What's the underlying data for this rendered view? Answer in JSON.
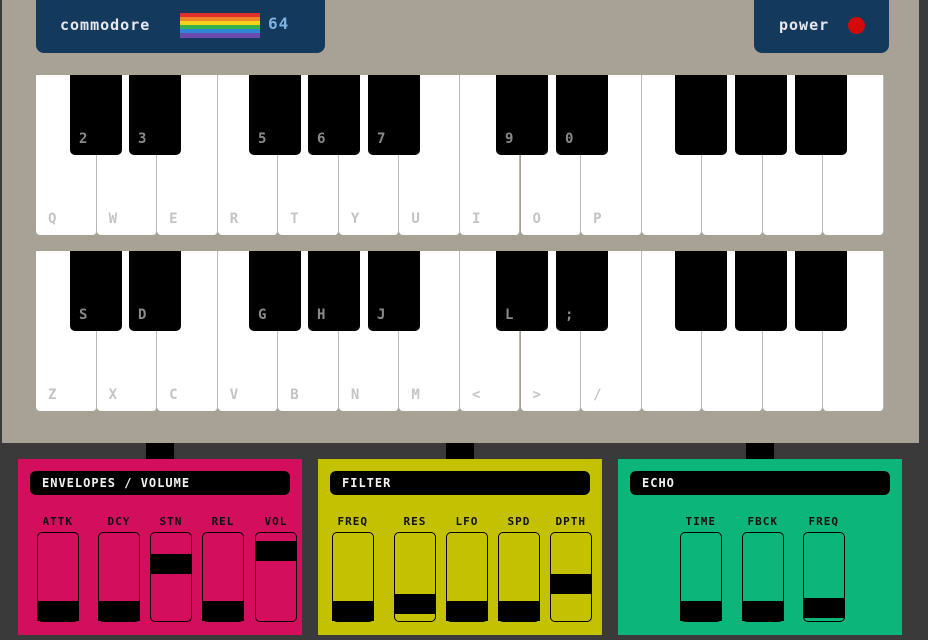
{
  "brand": {
    "name": "commodore",
    "model": "64"
  },
  "power": {
    "label": "power",
    "led_color": "#d40a0a"
  },
  "keyboard_top": {
    "white_labels": [
      "Q",
      "W",
      "E",
      "R",
      "T",
      "Y",
      "U",
      "I",
      "O",
      "P",
      "",
      "",
      "",
      ""
    ],
    "black_labels": [
      "2",
      "3",
      "5",
      "6",
      "7",
      "9",
      "0",
      "",
      "",
      ""
    ]
  },
  "keyboard_bottom": {
    "white_labels": [
      "Z",
      "X",
      "C",
      "V",
      "B",
      "N",
      "M",
      "<",
      ">",
      "/",
      "",
      "",
      "",
      ""
    ],
    "black_labels": [
      "S",
      "D",
      "G",
      "H",
      "J",
      "L",
      ";",
      "",
      "",
      ""
    ]
  },
  "panels": {
    "envelopes": {
      "title": "ENVELOPES / VOLUME",
      "color": "#d30e5c",
      "controls": [
        {
          "label": "ATTK",
          "level": 0.0
        },
        {
          "label": "DCY",
          "level": 0.0
        },
        {
          "label": "STN",
          "level": 0.7
        },
        {
          "label": "REL",
          "level": 0.0
        },
        {
          "label": "VOL",
          "level": 0.9
        }
      ]
    },
    "filter": {
      "title": "FILTER",
      "color": "#c4c102",
      "controls": [
        {
          "label": "FREQ",
          "level": 0.0
        },
        {
          "label": "RES",
          "level": 0.1
        },
        {
          "label": "LFO",
          "level": 0.0
        },
        {
          "label": "SPD",
          "level": 0.0
        },
        {
          "label": "DPTH",
          "level": 0.4
        }
      ]
    },
    "echo": {
      "title": "ECHO",
      "color": "#0cb57a",
      "controls": [
        {
          "label": "TIME",
          "level": 0.0
        },
        {
          "label": "FBCK",
          "level": 0.0
        },
        {
          "label": "FREQ",
          "level": 0.05
        }
      ]
    }
  }
}
